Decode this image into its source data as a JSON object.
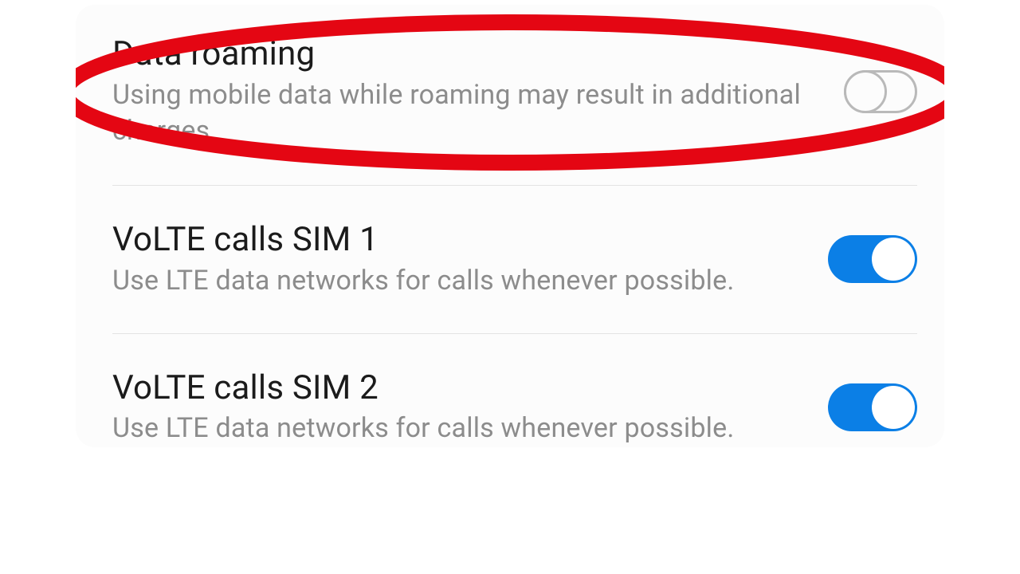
{
  "settings": [
    {
      "title": "Data roaming",
      "subtitle": "Using mobile data while roaming may result in additional charges.",
      "toggle": "off"
    },
    {
      "title": "VoLTE calls SIM 1",
      "subtitle": "Use LTE data networks for calls whenever possible.",
      "toggle": "on"
    },
    {
      "title": "VoLTE calls SIM 2",
      "subtitle": "Use LTE data networks for calls whenever possible.",
      "toggle": "on"
    }
  ],
  "annotation_color": "#e40613"
}
